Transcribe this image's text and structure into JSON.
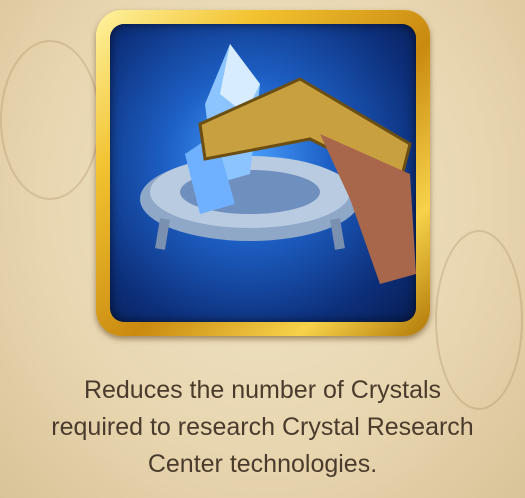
{
  "item": {
    "icon": "crystal-tongs-icon",
    "description_lines": [
      "Reduces the number of Crystals",
      "required to research Crystal Research",
      "Center technologies."
    ]
  },
  "colors": {
    "frame": "#f2c230",
    "icon_bg": "#1d5fc4",
    "text": "#4b3b2c",
    "background": "#ebdab5"
  }
}
